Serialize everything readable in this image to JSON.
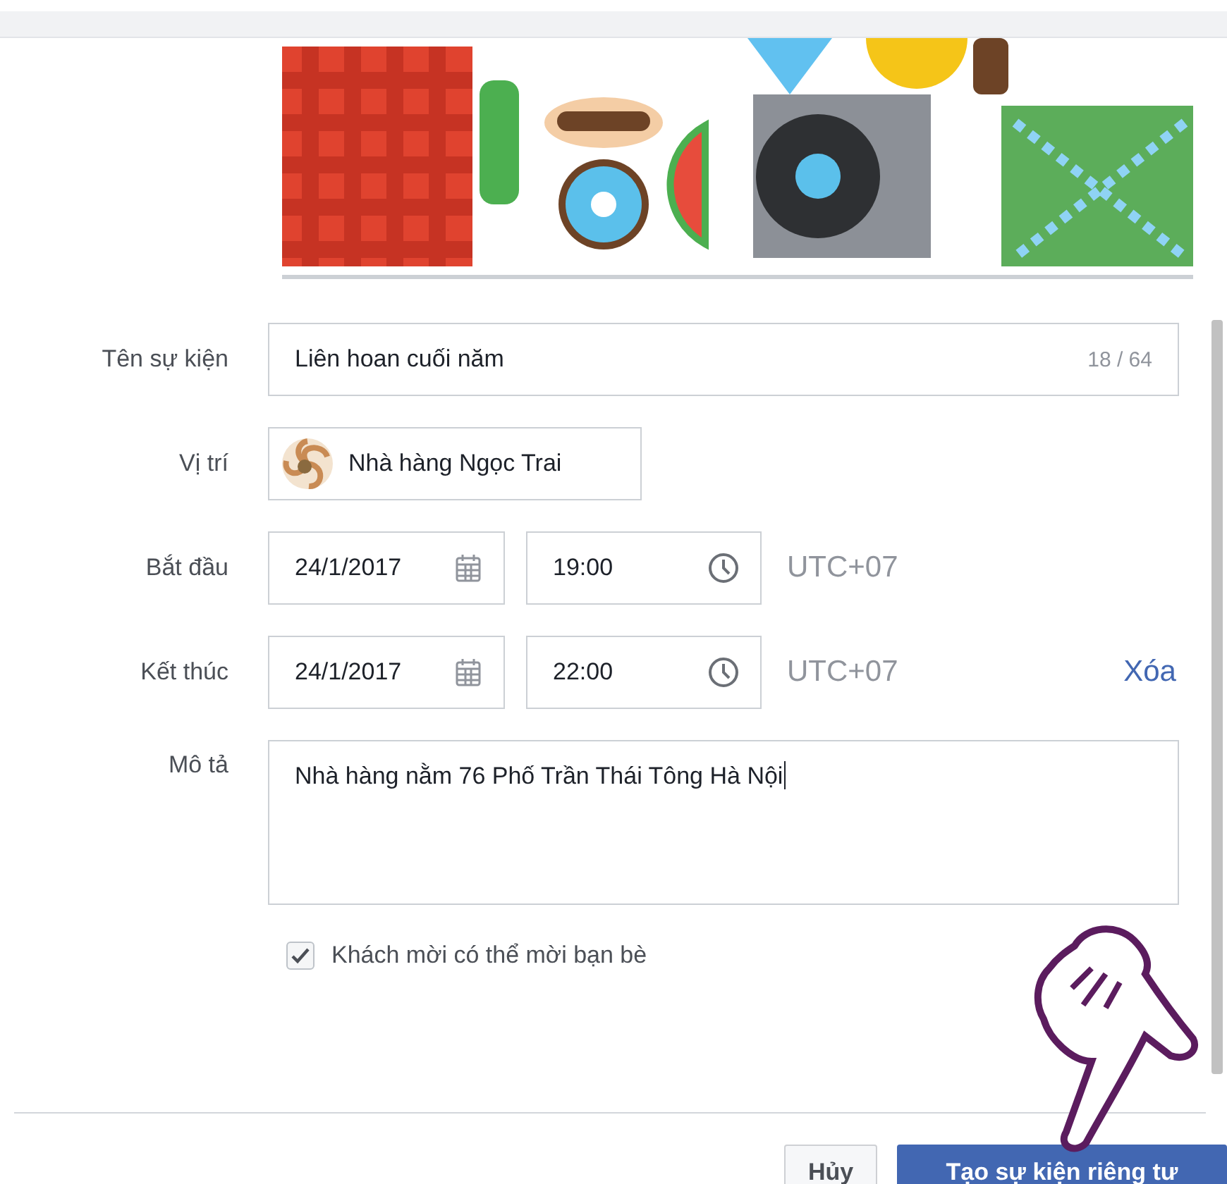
{
  "event_name": {
    "label": "Tên sự kiện",
    "value": "Liên hoan cuối năm",
    "counter": "18 / 64"
  },
  "location": {
    "label": "Vị trí",
    "value": "Nhà hàng Ngọc Trai"
  },
  "start": {
    "label": "Bắt đầu",
    "date": "24/1/2017",
    "time": "19:00",
    "timezone": "UTC+07"
  },
  "end": {
    "label": "Kết thúc",
    "date": "24/1/2017",
    "time": "22:00",
    "timezone": "UTC+07",
    "clear_link": "Xóa"
  },
  "description": {
    "label": "Mô tả",
    "value": "Nhà hàng nằm 76 Phố Trần Thái Tông Hà Nội"
  },
  "guests_can_invite": {
    "label": "Khách mời có thể mời bạn bè",
    "checked": true
  },
  "buttons": [
    {
      "label": "Hủy",
      "kind": "secondary"
    },
    {
      "label": "Tạo sự kiện riêng tư",
      "kind": "primary"
    }
  ]
}
